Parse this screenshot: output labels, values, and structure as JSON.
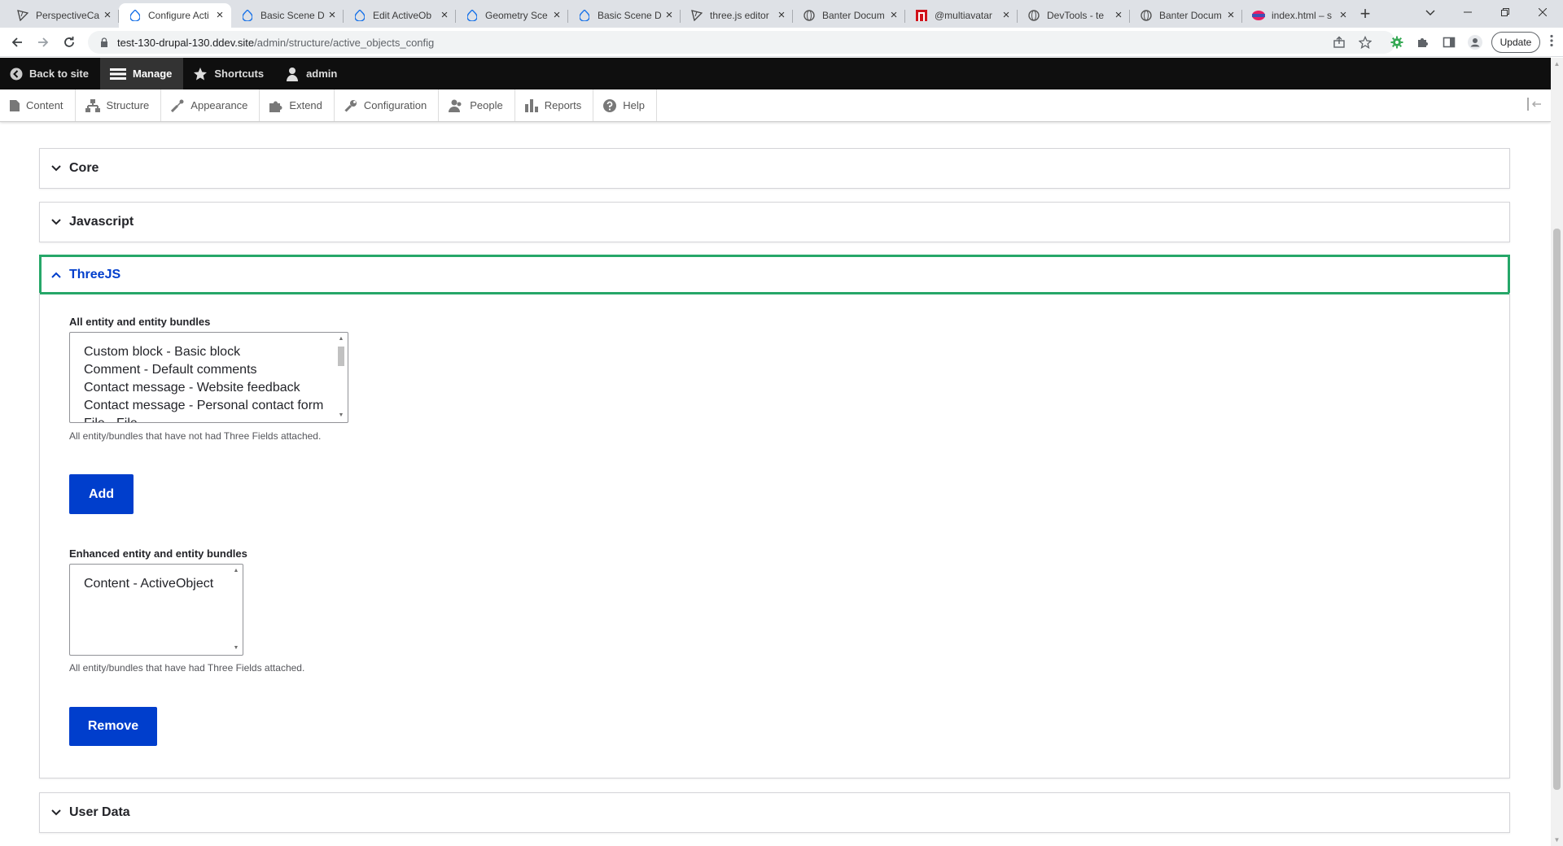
{
  "browser": {
    "tabs": [
      {
        "title": "PerspectiveCa",
        "icon": "threejs-icon"
      },
      {
        "title": "Configure Acti",
        "icon": "drupal-icon",
        "active": true
      },
      {
        "title": "Basic Scene D",
        "icon": "drupal-icon"
      },
      {
        "title": "Edit ActiveOb",
        "icon": "drupal-icon"
      },
      {
        "title": "Geometry Sce",
        "icon": "drupal-icon"
      },
      {
        "title": "Basic Scene D",
        "icon": "drupal-icon"
      },
      {
        "title": "three.js editor",
        "icon": "threejs-icon"
      },
      {
        "title": "Banter Docum",
        "icon": "globe-icon"
      },
      {
        "title": "@multiavatar",
        "icon": "multiavatar-icon"
      },
      {
        "title": "DevTools - te",
        "icon": "globe-icon"
      },
      {
        "title": "Banter Docum",
        "icon": "globe-icon"
      },
      {
        "title": "index.html – s",
        "icon": "vscode-icon"
      }
    ],
    "close_glyph": "×",
    "new_tab_glyph": "+",
    "url_host": "test-130-drupal-130.ddev.site",
    "url_path": "/admin/structure/active_objects_config",
    "update_label": "Update",
    "colors": {
      "tabstrip": "#dee1e6",
      "omnibox": "#f1f3f4"
    }
  },
  "admin_toolbar": {
    "back_to_site": "Back to site",
    "manage": "Manage",
    "shortcuts": "Shortcuts",
    "user": "admin"
  },
  "tray": {
    "items": [
      {
        "label": "Content",
        "icon": "content-icon"
      },
      {
        "label": "Structure",
        "icon": "structure-icon"
      },
      {
        "label": "Appearance",
        "icon": "appearance-icon"
      },
      {
        "label": "Extend",
        "icon": "extend-icon"
      },
      {
        "label": "Configuration",
        "icon": "wrench-icon"
      },
      {
        "label": "People",
        "icon": "people-icon"
      },
      {
        "label": "Reports",
        "icon": "reports-icon"
      },
      {
        "label": "Help",
        "icon": "help-icon"
      }
    ]
  },
  "sections": {
    "core": "Core",
    "javascript": "Javascript",
    "threejs": "ThreeJS",
    "user_data": "User Data"
  },
  "threejs": {
    "all_label": "All entity and entity bundles",
    "all_options": [
      "Custom block - Basic block",
      "Comment - Default comments",
      "Contact message - Website feedback",
      "Contact message - Personal contact form",
      "File - File"
    ],
    "all_description": "All entity/bundles that have not had Three Fields attached.",
    "add_label": "Add",
    "enhanced_label": "Enhanced entity and entity bundles",
    "enhanced_options": [
      "Content - ActiveObject"
    ],
    "enhanced_description": "All entity/bundles that have had Three Fields attached.",
    "remove_label": "Remove"
  },
  "colors": {
    "primary_button": "#003ecc",
    "focus_border": "#26a769",
    "admin_bar": "#0f0f0f"
  }
}
